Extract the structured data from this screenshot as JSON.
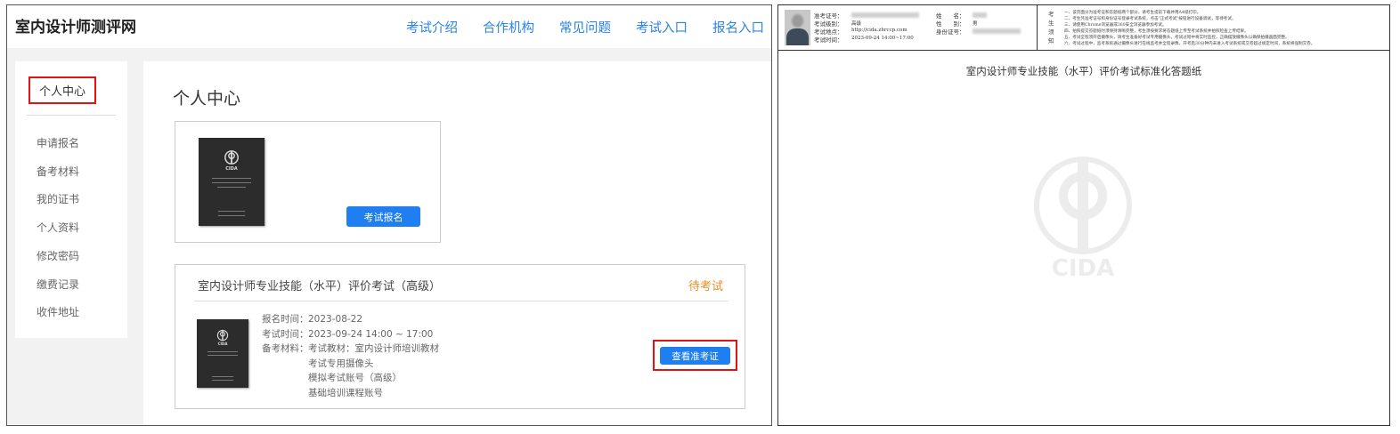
{
  "left": {
    "logo": "室内设计师测评网",
    "nav": [
      "考试介绍",
      "合作机构",
      "常见问题",
      "考试入口",
      "报名入口"
    ],
    "sidebar": {
      "active": "个人中心",
      "items": [
        "申请报名",
        "备考材料",
        "我的证书",
        "个人资料",
        "修改密码",
        "缴费记录",
        "收件地址"
      ]
    },
    "main": {
      "title": "个人中心",
      "apply_button": "考试报名",
      "exam": {
        "title": "室内设计师专业技能（水平）评价考试（高级）",
        "status": "待考试",
        "reg_label": "报名时间：",
        "reg_value": "2023-08-22",
        "time_label": "考试时间：",
        "time_value": "2023-09-24 14:00 ~ 17:00",
        "materials_label": "备考材料：",
        "materials": [
          "考试教材：室内设计师培训教材",
          "考试专用摄像头",
          "模拟考试账号（高级）",
          "基础培训课程账号"
        ],
        "view_button": "查看准考证"
      },
      "book_emblem": "CIDA"
    }
  },
  "right": {
    "fields": {
      "ticket_label": "准考证号：",
      "level_label": "考试级别：",
      "level_value": "高级",
      "location_label": "考试地点：",
      "location_value": "http://cida.zhrccp.com",
      "time_label": "考试时间：",
      "time_value": "2023-09-24 14:00~17:00",
      "name_label": "姓　　名：",
      "gender_label": "性　　别：",
      "gender_value": "男",
      "id_label": "身份证号："
    },
    "notice_label": [
      "考",
      "生",
      "须",
      "知"
    ],
    "notice_lines": [
      "一、该页面分为准考证和答题纸两个部分，请考生提前下载并用A4纸打印。",
      "二、考生凭准考证号和身份证号登录考试系统，点击\"正式考试\"按钮进行设备调试，等待考试。",
      "三、请使用Chrome浏览器或360安全浏览器参加考试。",
      "四、拍照提交答题纸时须保持清晰完整，考生须按要求将答题纸上传至考试系统并拍照检查上传结果。",
      "五、考试全程须开启摄像头，请考生准备好考试专用摄像头，考试过程中将实时监控，正确摆放摄像头以确保拍摄画面完整。",
      "六、考试过程中，监考系统通过摄像头进行在线监考并全程录像。开考后30分钟内未进入考试系统或交卷超过规定时间，系统将强制交卷。"
    ],
    "answer_sheet_title": "室内设计师专业技能（水平）评价考试标准化答题纸",
    "watermark_text": "CIDA"
  }
}
